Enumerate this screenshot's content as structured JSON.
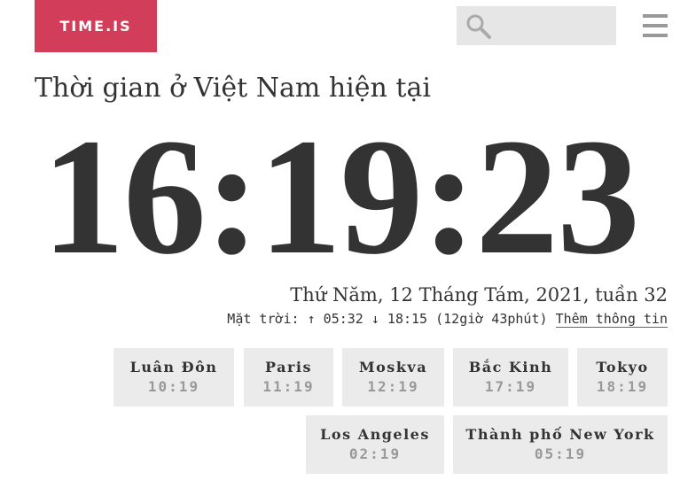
{
  "header": {
    "logo": "TIME.IS",
    "search_value": "",
    "search_icon": "search-icon",
    "menu_icon": "hamburger-menu-icon"
  },
  "main": {
    "title": "Thời gian ở Việt Nam hiện tại",
    "time": "16:19:23",
    "date": "Thứ Năm, 12 Tháng Tám, 2021, tuần 32",
    "sun": {
      "label": "Mặt trời: ↑ 05:32 ↓ 18:15 (12giờ 43phút)",
      "more_link": "Thêm thông tin"
    }
  },
  "cities": [
    {
      "name": "Luân Đôn",
      "time": "10:19"
    },
    {
      "name": "Paris",
      "time": "11:19"
    },
    {
      "name": "Moskva",
      "time": "12:19"
    },
    {
      "name": "Bắc Kinh",
      "time": "17:19"
    },
    {
      "name": "Tokyo",
      "time": "18:19"
    },
    {
      "name": "Los Angeles",
      "time": "02:19"
    },
    {
      "name": "Thành phố New York",
      "time": "05:19"
    }
  ],
  "colors": {
    "brand": "#d23d5a",
    "text": "#333333",
    "muted": "#999999",
    "panel": "#ebebeb"
  }
}
